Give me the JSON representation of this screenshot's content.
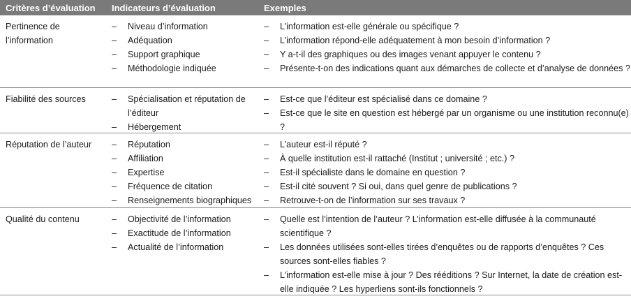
{
  "headers": [
    "Critères d’évaluation",
    "Indicateurs d’évaluation",
    "Exemples"
  ],
  "rows": [
    {
      "critere": "Pertinence de l’information",
      "indicateurs": [
        "Niveau d’information",
        "Adéquation",
        "Support graphique",
        "Méthodologie indiquée"
      ],
      "exemples": [
        "L’information est-elle générale ou spécifique ?",
        "L’information répond-elle adéquatement à mon besoin d’information ?",
        "Y a-t-il des graphiques ou des images venant appuyer le contenu ?",
        "Présente-t-on des indications quant aux démarches de collecte et d’analyse de données ?"
      ]
    },
    {
      "critere": "Fiabilité des sources",
      "indicateurs": [
        "Spécialisation et réputation de l’éditeur",
        "Hébergement"
      ],
      "exemples": [
        "Est-ce que l’éditeur est spécialisé dans ce domaine ?",
        "Est-ce que le site en question est hébergé par un organisme ou une institution reconnu(e) ?"
      ]
    },
    {
      "critere": "Réputation de l’auteur",
      "indicateurs": [
        "Réputation",
        "Affiliation",
        "Expertise",
        "Fréquence de citation",
        "Renseignements biographiques"
      ],
      "exemples": [
        "L’auteur est-il réputé ?",
        "À quelle institution est-il rattaché (Institut ; université ; etc.) ?",
        "Est-il spécialiste dans le domaine en question ?",
        "Est-il cité souvent ? Si oui, dans quel genre de publications ?",
        "Retrouve-t-on de l’information sur ses travaux ?"
      ]
    },
    {
      "critere": "Qualité du contenu",
      "indicateurs": [
        "Objectivité de l’information",
        "Exactitude de l’information",
        "Actualité de l’information"
      ],
      "exemples": [
        "Quelle est l’intention de l’auteur ? L’information est-elle diffusée à la communauté scientifique ?",
        "Les données utilisées sont-elles tirées d’enquêtes ou de rapports d’enquêtes ? Ces sources sont-elles fiables ?",
        "L’information est-elle mise à jour ? Des rééditions ? Sur Internet, la date de création est-elle indiquée ? Les hyperliens sont-ils fonctionnels ?"
      ]
    }
  ]
}
